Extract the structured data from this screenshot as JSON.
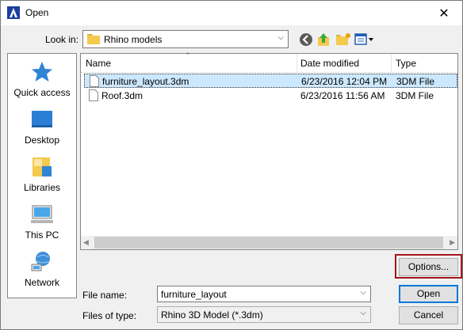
{
  "window": {
    "title": "Open",
    "close_glyph": "✕"
  },
  "lookin": {
    "label": "Look in:",
    "value": "Rhino models"
  },
  "toolbar": {
    "icons": [
      "back-icon",
      "up-folder-icon",
      "new-folder-icon",
      "view-menu-icon"
    ]
  },
  "places": [
    {
      "label": "Quick access",
      "icon": "quick-access-icon"
    },
    {
      "label": "Desktop",
      "icon": "desktop-icon"
    },
    {
      "label": "Libraries",
      "icon": "libraries-icon"
    },
    {
      "label": "This PC",
      "icon": "this-pc-icon"
    },
    {
      "label": "Network",
      "icon": "network-icon"
    }
  ],
  "columns": {
    "name": "Name",
    "date": "Date modified",
    "type": "Type"
  },
  "files": [
    {
      "name": "furniture_layout.3dm",
      "date": "6/23/2016 12:04 PM",
      "type": "3DM File",
      "selected": true
    },
    {
      "name": "Roof.3dm",
      "date": "6/23/2016 11:56 AM",
      "type": "3DM File",
      "selected": false
    }
  ],
  "buttons": {
    "options": "Options...",
    "open": "Open",
    "cancel": "Cancel"
  },
  "filename": {
    "label": "File name:",
    "value": "furniture_layout"
  },
  "filetype": {
    "label": "Files of type:",
    "value": "Rhino 3D Model (*.3dm)"
  },
  "colors": {
    "selection": "#cce8ff",
    "highlight_border": "#a4161a",
    "default_button": "#0078d7"
  }
}
